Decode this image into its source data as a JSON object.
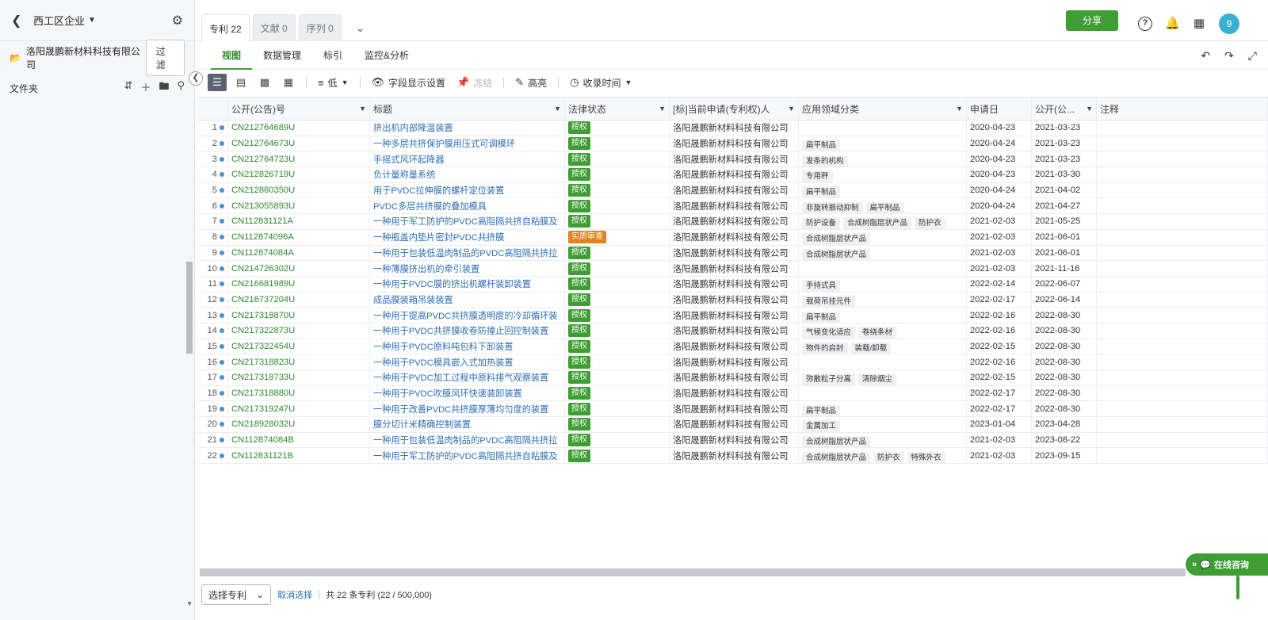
{
  "sidebar": {
    "title": "西工区企业",
    "company": "洛阳晟鹏新材料科技有限公司",
    "filter_label": "过滤",
    "folder_label": "文件夹"
  },
  "tabs": [
    {
      "label": "专利 22"
    },
    {
      "label": "文献 0"
    },
    {
      "label": "序列 0"
    }
  ],
  "header": {
    "share_label": "分享",
    "avatar_text": "9",
    "help_glyph": "?"
  },
  "subnav": [
    {
      "label": "视图"
    },
    {
      "label": "数据管理"
    },
    {
      "label": "标引"
    },
    {
      "label": "监控&分析"
    }
  ],
  "toolbar": {
    "density_label": "低",
    "fields_label": "字段显示设置",
    "freeze_label": "冻结",
    "highlight_label": "高亮",
    "sort_label": "收录时间"
  },
  "columns": [
    "公开(公告)号",
    "标题",
    "法律状态",
    "[标]当前申请(专利权)人",
    "应用领域分类",
    "申请日",
    "公开(公...",
    "注释"
  ],
  "rows": [
    {
      "idx": "1",
      "num": "CN212764689U",
      "title": "挤出机内部降温装置",
      "status": "授权",
      "applicant": "洛阳晟鹏新材料科技有限公司",
      "tags": [],
      "d1": "2020-04-23",
      "d2": "2021-03-23"
    },
    {
      "idx": "2",
      "num": "CN212764673U",
      "title": "一种多层共挤保护膜用压式可调模环",
      "status": "授权",
      "applicant": "洛阳晟鹏新材料科技有限公司",
      "tags": [
        "扁平制品"
      ],
      "d1": "2020-04-24",
      "d2": "2021-03-23"
    },
    {
      "idx": "3",
      "num": "CN212764723U",
      "title": "手摇式风环起降器",
      "status": "授权",
      "applicant": "洛阳晟鹏新材料科技有限公司",
      "tags": [
        "发条的机构"
      ],
      "d1": "2020-04-23",
      "d2": "2021-03-23"
    },
    {
      "idx": "4",
      "num": "CN212826719U",
      "title": "负计量称量系统",
      "status": "授权",
      "applicant": "洛阳晟鹏新材料科技有限公司",
      "tags": [
        "专用秤"
      ],
      "d1": "2020-04-23",
      "d2": "2021-03-30"
    },
    {
      "idx": "5",
      "num": "CN212860350U",
      "title": "用于PVDC拉伸膜的螺杆定位装置",
      "status": "授权",
      "applicant": "洛阳晟鹏新材料科技有限公司",
      "tags": [
        "扁平制品"
      ],
      "d1": "2020-04-24",
      "d2": "2021-04-02"
    },
    {
      "idx": "6",
      "num": "CN213055893U",
      "title": "PVDC多层共挤膜的叠加模具",
      "status": "授权",
      "applicant": "洛阳晟鹏新材料科技有限公司",
      "tags": [
        "非旋转振动抑制",
        "扁平制品"
      ],
      "d1": "2020-04-24",
      "d2": "2021-04-27"
    },
    {
      "idx": "7",
      "num": "CN112831121A",
      "title": "一种用于军工防护的PVDC高阻隔共挤自粘膜及",
      "status": "授权",
      "applicant": "洛阳晟鹏新材料科技有限公司",
      "tags": [
        "防护设备",
        "合成树脂层状产品",
        "防护衣"
      ],
      "d1": "2021-02-03",
      "d2": "2021-05-25"
    },
    {
      "idx": "8",
      "num": "CN112874096A",
      "title": "一种瓶盖内垫片密封PVDC共挤膜",
      "status": "实质审查",
      "applicant": "洛阳晟鹏新材料科技有限公司",
      "tags": [
        "合成树脂层状产品"
      ],
      "d1": "2021-02-03",
      "d2": "2021-06-01"
    },
    {
      "idx": "9",
      "num": "CN112874084A",
      "title": "一种用于包装低温肉制品的PVDC高阻隔共挤拉",
      "status": "授权",
      "applicant": "洛阳晟鹏新材料科技有限公司",
      "tags": [
        "合成树脂层状产品"
      ],
      "d1": "2021-02-03",
      "d2": "2021-06-01"
    },
    {
      "idx": "10",
      "num": "CN214726302U",
      "title": "一种薄膜挤出机的牵引装置",
      "status": "授权",
      "applicant": "洛阳晟鹏新材料科技有限公司",
      "tags": [],
      "d1": "2021-02-03",
      "d2": "2021-11-16"
    },
    {
      "idx": "11",
      "num": "CN216681989U",
      "title": "一种用于PVDC膜的挤出机螺杆装卸装置",
      "status": "授权",
      "applicant": "洛阳晟鹏新材料科技有限公司",
      "tags": [
        "手持式具"
      ],
      "d1": "2022-02-14",
      "d2": "2022-06-07"
    },
    {
      "idx": "12",
      "num": "CN216737204U",
      "title": "成品膜装箱吊装装置",
      "status": "授权",
      "applicant": "洛阳晟鹏新材料科技有限公司",
      "tags": [
        "载荷吊挂元件"
      ],
      "d1": "2022-02-17",
      "d2": "2022-06-14"
    },
    {
      "idx": "13",
      "num": "CN217318870U",
      "title": "一种用于提高PVDC共挤膜透明度的冷却循环装",
      "status": "授权",
      "applicant": "洛阳晟鹏新材料科技有限公司",
      "tags": [
        "扁平制品"
      ],
      "d1": "2022-02-16",
      "d2": "2022-08-30"
    },
    {
      "idx": "14",
      "num": "CN217322873U",
      "title": "一种用于PVDC共挤膜收卷防撞止回控制装置",
      "status": "授权",
      "applicant": "洛阳晟鹏新材料科技有限公司",
      "tags": [
        "气候变化适应",
        "卷绕条材"
      ],
      "d1": "2022-02-16",
      "d2": "2022-08-30"
    },
    {
      "idx": "15",
      "num": "CN217322454U",
      "title": "一种用于PVDC原料吨包料下卸装置",
      "status": "授权",
      "applicant": "洛阳晟鹏新材料科技有限公司",
      "tags": [
        "物件的启封",
        "装载/卸载"
      ],
      "d1": "2022-02-15",
      "d2": "2022-08-30"
    },
    {
      "idx": "16",
      "num": "CN217318823U",
      "title": "一种用于PVDC模具嵌入式加热装置",
      "status": "授权",
      "applicant": "洛阳晟鹏新材料科技有限公司",
      "tags": [],
      "d1": "2022-02-16",
      "d2": "2022-08-30"
    },
    {
      "idx": "17",
      "num": "CN217318733U",
      "title": "一种用于PVDC加工过程中原料排气观察装置",
      "status": "授权",
      "applicant": "洛阳晟鹏新材料科技有限公司",
      "tags": [
        "弥散粒子分离",
        "清除烟尘"
      ],
      "d1": "2022-02-15",
      "d2": "2022-08-30"
    },
    {
      "idx": "18",
      "num": "CN217318880U",
      "title": "一种用于PVDC吹膜风环快速装卸装置",
      "status": "授权",
      "applicant": "洛阳晟鹏新材料科技有限公司",
      "tags": [],
      "d1": "2022-02-17",
      "d2": "2022-08-30"
    },
    {
      "idx": "19",
      "num": "CN217319247U",
      "title": "一种用于改善PVDC共挤膜厚薄均匀度的装置",
      "status": "授权",
      "applicant": "洛阳晟鹏新材料科技有限公司",
      "tags": [
        "扁平制品"
      ],
      "d1": "2022-02-17",
      "d2": "2022-08-30"
    },
    {
      "idx": "20",
      "num": "CN218928032U",
      "title": "膜分切计米精确控制装置",
      "status": "授权",
      "applicant": "洛阳晟鹏新材料科技有限公司",
      "tags": [
        "金属加工"
      ],
      "d1": "2023-01-04",
      "d2": "2023-04-28"
    },
    {
      "idx": "21",
      "num": "CN112874084B",
      "title": "一种用于包装低温肉制品的PVDC高阻隔共挤拉",
      "status": "授权",
      "applicant": "洛阳晟鹏新材料科技有限公司",
      "tags": [
        "合成树脂层状产品"
      ],
      "d1": "2021-02-03",
      "d2": "2023-08-22"
    },
    {
      "idx": "22",
      "num": "CN112831121B",
      "title": "一种用于军工防护的PVDC高阻隔共挤自粘膜及",
      "status": "授权",
      "applicant": "洛阳晟鹏新材料科技有限公司",
      "tags": [
        "合成树脂层状产品",
        "防护衣",
        "特殊外衣"
      ],
      "d1": "2021-02-03",
      "d2": "2023-09-15"
    }
  ],
  "footer": {
    "select_label": "选择专利",
    "cancel_label": "取消选择",
    "count_text": "共 22 条专利 (22 / 500,000)"
  },
  "chat_label": "在线咨询",
  "colors": {
    "accent": "#3e9e33",
    "link": "#2f6eb5",
    "pending": "#e0821f"
  }
}
